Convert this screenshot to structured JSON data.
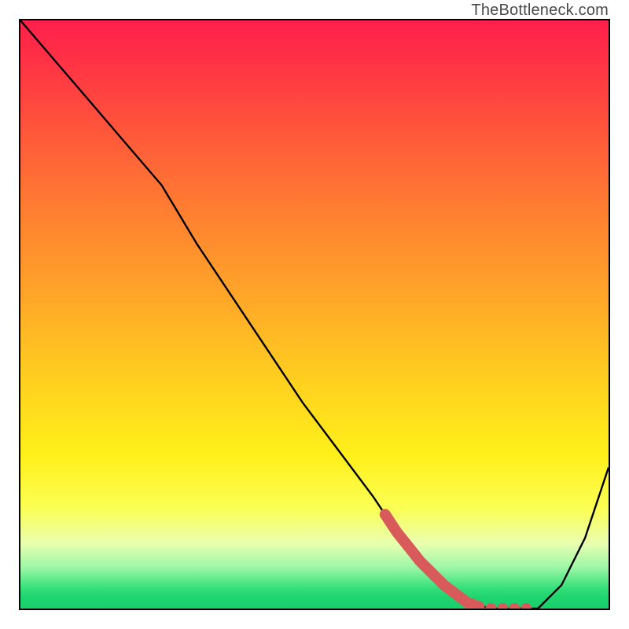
{
  "watermark": "TheBottleneck.com",
  "colors": {
    "curve_stroke": "#000000",
    "highlight_stroke": "#d85a5a",
    "frame_stroke": "#000000"
  },
  "chart_data": {
    "type": "line",
    "title": "",
    "xlabel": "",
    "ylabel": "",
    "xlim": [
      0,
      100
    ],
    "ylim": [
      0,
      100
    ],
    "grid": false,
    "series": [
      {
        "name": "bottleneck-curve",
        "x": [
          0,
          6,
          12,
          18,
          24,
          30,
          36,
          42,
          48,
          54,
          60,
          64,
          68,
          72,
          76,
          80,
          84,
          88,
          92,
          96,
          100
        ],
        "y": [
          100,
          93,
          86,
          79,
          72,
          62,
          53,
          44,
          35,
          27,
          19,
          13,
          8,
          4,
          1,
          0,
          0,
          0,
          4,
          12,
          24
        ]
      }
    ],
    "highlight": {
      "name": "bottleneck-highlight",
      "x": [
        62,
        64,
        66,
        68,
        70,
        72,
        74,
        76,
        78,
        80,
        82,
        84,
        86
      ],
      "y": [
        16,
        13,
        10.5,
        8,
        6,
        4,
        2.5,
        1,
        0.3,
        0,
        0,
        0,
        0
      ],
      "style": "thick-dotted"
    }
  }
}
